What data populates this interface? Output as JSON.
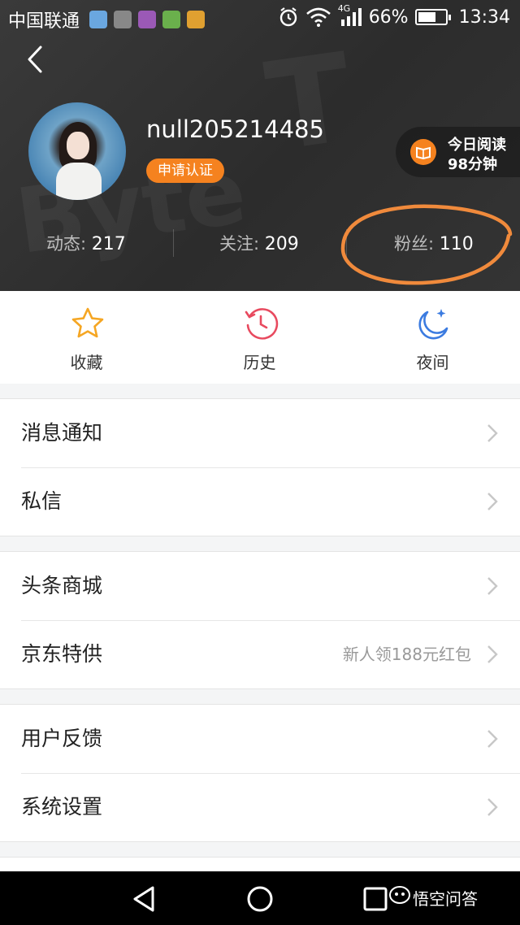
{
  "status_bar": {
    "carrier": "中国联通",
    "network": "4G",
    "battery": "66%",
    "battery_level": 0.66,
    "time": "13:34"
  },
  "profile": {
    "username": "null205214485",
    "certify_label": "申请认证",
    "reading": {
      "line1": "今日阅读",
      "line2": "98分钟"
    },
    "stats": [
      {
        "label": "动态:",
        "value": "217"
      },
      {
        "label": "关注:",
        "value": "209"
      },
      {
        "label": "粉丝:",
        "value": "110"
      }
    ]
  },
  "quick_actions": [
    {
      "label": "收藏",
      "icon": "star-icon"
    },
    {
      "label": "历史",
      "icon": "history-clock-icon"
    },
    {
      "label": "夜间",
      "icon": "moon-icon"
    }
  ],
  "menu_groups": [
    [
      {
        "label": "消息通知",
        "hint": ""
      },
      {
        "label": "私信",
        "hint": ""
      }
    ],
    [
      {
        "label": "头条商城",
        "hint": ""
      },
      {
        "label": "京东特供",
        "hint": "新人领188元红包"
      }
    ],
    [
      {
        "label": "用户反馈",
        "hint": ""
      },
      {
        "label": "系统设置",
        "hint": ""
      }
    ]
  ],
  "watermark": {
    "brand": "悟空问答"
  },
  "colors": {
    "accent": "#f5821f",
    "header_bg": "#323232",
    "history_icon": "#e84a5f",
    "moon_icon": "#3b7be0",
    "star_icon": "#f5a623"
  }
}
